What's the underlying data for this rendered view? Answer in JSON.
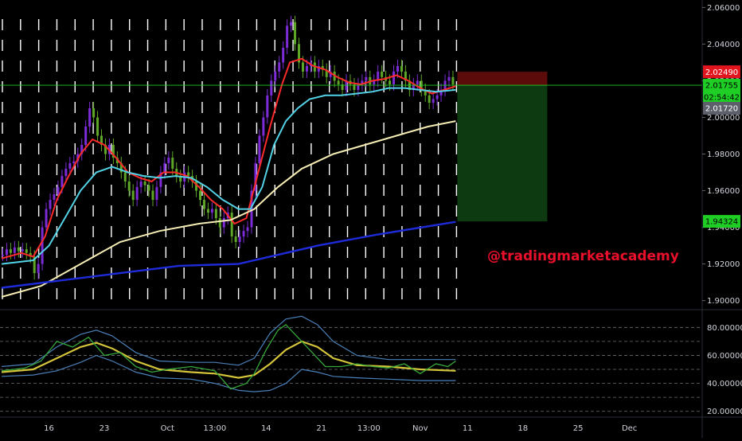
{
  "watermark": "@tradingmarketacademy",
  "colors": {
    "background": "#000000",
    "axis_text": "#d1d4dc",
    "candle_up": "#7b2cd6",
    "candle_down": "#5ea628",
    "ema_fast": "#ff2a2a",
    "ema_mid": "#53d2e6",
    "ema_slow": "#f6edb4",
    "ema_long": "#1e2bd8",
    "rsi_line": "#36a83a",
    "rsi_mean": "#d4c43a",
    "rsi_bands": "#4a80b8",
    "short_stop_zone": "#5c0b0b",
    "short_target_zone": "#0d3a10"
  },
  "price_axis": {
    "ticks": [
      "2.06000",
      "2.04000",
      "2.02000",
      "2.00000",
      "1.98000",
      "1.96000",
      "1.94000",
      "1.92000",
      "1.90000"
    ],
    "tick_values": [
      2.06,
      2.04,
      2.02,
      2.0,
      1.98,
      1.96,
      1.94,
      1.92,
      1.9
    ],
    "range": [
      1.8955,
      2.0632
    ]
  },
  "price_tags": [
    {
      "label": "2.02490",
      "value": 2.0249,
      "color": "#e0151e",
      "text_color": "#ffffff"
    },
    {
      "label": "2.01755",
      "value": 2.01755,
      "color": "#1fce24",
      "text_color": "#000000"
    },
    {
      "label": "02:54:42",
      "value": 2.0112,
      "color": "#1fce24",
      "text_color": "#000000"
    },
    {
      "label": "2.01720",
      "value": 2.005,
      "color": "#5d606b",
      "text_color": "#ffffff"
    },
    {
      "label": "1.94324",
      "value": 1.94324,
      "color": "#1fce24",
      "text_color": "#000000"
    }
  ],
  "indicator_axis": {
    "ticks": [
      "80.00000",
      "60.00000",
      "40.00000",
      "20.00000"
    ],
    "tick_values": [
      80,
      60,
      40,
      20
    ],
    "range": [
      17,
      91
    ]
  },
  "time_axis": {
    "labels": [
      "16",
      "23",
      "Oct",
      "13:00",
      "14",
      "21",
      "13:00",
      "Nov",
      "11",
      "18",
      "25",
      "Dec"
    ],
    "bar_index": [
      12,
      26,
      42,
      54,
      67,
      81,
      93,
      106,
      118,
      132,
      146,
      159
    ]
  },
  "chart_data": {
    "type": "candlestick",
    "title": "",
    "xlabel": "",
    "ylabel": "",
    "bar_count": 115,
    "last_price": 2.01755,
    "ylim": [
      1.8955,
      2.0632
    ],
    "ema_fast_period_note": "",
    "closes": [
      1.925,
      1.928,
      1.926,
      1.929,
      1.927,
      1.928,
      1.926,
      1.924,
      1.915,
      1.92,
      1.94,
      1.95,
      1.955,
      1.958,
      1.962,
      1.968,
      1.972,
      1.975,
      1.976,
      1.98,
      1.985,
      1.995,
      2.005,
      2.0,
      1.99,
      1.985,
      1.98,
      1.985,
      1.978,
      1.975,
      1.97,
      1.965,
      1.96,
      1.955,
      1.962,
      1.965,
      1.963,
      1.96,
      1.955,
      1.962,
      1.97,
      1.975,
      1.978,
      1.972,
      1.968,
      1.965,
      1.97,
      1.968,
      1.965,
      1.96,
      1.955,
      1.95,
      1.948,
      1.95,
      1.945,
      1.94,
      1.945,
      1.948,
      1.935,
      1.932,
      1.935,
      1.938,
      1.94,
      1.96,
      1.975,
      1.99,
      2.0,
      2.012,
      2.02,
      2.025,
      2.03,
      2.038,
      2.05,
      2.052,
      2.04,
      2.03,
      2.025,
      2.028,
      2.03,
      2.025,
      2.028,
      2.026,
      2.022,
      2.025,
      2.02,
      2.018,
      2.015,
      2.02,
      2.018,
      2.015,
      2.018,
      2.02,
      2.022,
      2.018,
      2.02,
      2.025,
      2.022,
      2.02,
      2.018,
      2.025,
      2.028,
      2.025,
      2.02,
      2.015,
      2.018,
      2.02,
      2.015,
      2.012,
      2.008,
      2.01,
      2.012,
      2.015,
      2.02,
      2.022,
      2.018
    ],
    "series": [
      {
        "name": "",
        "key": "ema_fast",
        "color": "#ff2a2a",
        "points": [
          [
            0,
            1.923
          ],
          [
            5,
            1.926
          ],
          [
            8,
            1.924
          ],
          [
            11,
            1.935
          ],
          [
            14,
            1.955
          ],
          [
            17,
            1.968
          ],
          [
            20,
            1.98
          ],
          [
            23,
            1.988
          ],
          [
            26,
            1.985
          ],
          [
            29,
            1.978
          ],
          [
            32,
            1.97
          ],
          [
            35,
            1.967
          ],
          [
            38,
            1.965
          ],
          [
            41,
            1.97
          ],
          [
            44,
            1.97
          ],
          [
            47,
            1.968
          ],
          [
            50,
            1.962
          ],
          [
            53,
            1.955
          ],
          [
            56,
            1.95
          ],
          [
            59,
            1.942
          ],
          [
            62,
            1.945
          ],
          [
            65,
            1.97
          ],
          [
            68,
            1.995
          ],
          [
            71,
            2.018
          ],
          [
            73,
            2.03
          ],
          [
            76,
            2.032
          ],
          [
            79,
            2.028
          ],
          [
            82,
            2.026
          ],
          [
            85,
            2.022
          ],
          [
            88,
            2.019
          ],
          [
            91,
            2.018
          ],
          [
            94,
            2.02
          ],
          [
            97,
            2.021
          ],
          [
            100,
            2.023
          ],
          [
            103,
            2.02
          ],
          [
            106,
            2.016
          ],
          [
            109,
            2.013
          ],
          [
            112,
            2.015
          ],
          [
            115,
            2.017
          ]
        ]
      },
      {
        "name": "",
        "key": "ema_mid",
        "color": "#53d2e6",
        "points": [
          [
            0,
            1.92
          ],
          [
            8,
            1.922
          ],
          [
            12,
            1.93
          ],
          [
            16,
            1.945
          ],
          [
            20,
            1.96
          ],
          [
            24,
            1.97
          ],
          [
            28,
            1.973
          ],
          [
            32,
            1.97
          ],
          [
            36,
            1.968
          ],
          [
            40,
            1.967
          ],
          [
            44,
            1.968
          ],
          [
            48,
            1.967
          ],
          [
            52,
            1.962
          ],
          [
            56,
            1.955
          ],
          [
            60,
            1.95
          ],
          [
            63,
            1.95
          ],
          [
            66,
            1.962
          ],
          [
            69,
            1.985
          ],
          [
            72,
            1.998
          ],
          [
            75,
            2.005
          ],
          [
            78,
            2.01
          ],
          [
            82,
            2.012
          ],
          [
            86,
            2.012
          ],
          [
            90,
            2.013
          ],
          [
            94,
            2.014
          ],
          [
            98,
            2.016
          ],
          [
            102,
            2.016
          ],
          [
            106,
            2.015
          ],
          [
            110,
            2.014
          ],
          [
            115,
            2.015
          ]
        ]
      },
      {
        "name": "",
        "key": "ema_slow",
        "color": "#f6edb4",
        "points": [
          [
            0,
            1.902
          ],
          [
            10,
            1.908
          ],
          [
            20,
            1.92
          ],
          [
            30,
            1.932
          ],
          [
            40,
            1.938
          ],
          [
            50,
            1.942
          ],
          [
            58,
            1.944
          ],
          [
            64,
            1.95
          ],
          [
            70,
            1.962
          ],
          [
            76,
            1.972
          ],
          [
            84,
            1.98
          ],
          [
            92,
            1.985
          ],
          [
            100,
            1.99
          ],
          [
            108,
            1.995
          ],
          [
            115,
            1.998
          ]
        ]
      },
      {
        "name": "",
        "key": "ema_long",
        "color": "#1e2bd8",
        "points": [
          [
            0,
            1.907
          ],
          [
            15,
            1.911
          ],
          [
            30,
            1.915
          ],
          [
            45,
            1.919
          ],
          [
            60,
            1.92
          ],
          [
            70,
            1.925
          ],
          [
            80,
            1.93
          ],
          [
            95,
            1.936
          ],
          [
            115,
            1.943
          ]
        ]
      }
    ],
    "position_tool": {
      "type": "short",
      "entry": 2.01755,
      "stop": 2.0249,
      "target": 1.94324
    },
    "indicator": {
      "name": "",
      "ylim": [
        17,
        91
      ],
      "levels": [
        80,
        70,
        60,
        50,
        40,
        30,
        20
      ],
      "rsi": [
        [
          0,
          49
        ],
        [
          6,
          51
        ],
        [
          10,
          56
        ],
        [
          14,
          70
        ],
        [
          18,
          66
        ],
        [
          22,
          73
        ],
        [
          26,
          60
        ],
        [
          30,
          62
        ],
        [
          34,
          52
        ],
        [
          38,
          48
        ],
        [
          42,
          50
        ],
        [
          48,
          52
        ],
        [
          54,
          49
        ],
        [
          58,
          36
        ],
        [
          62,
          40
        ],
        [
          64,
          47
        ],
        [
          67,
          64
        ],
        [
          70,
          78
        ],
        [
          72,
          82
        ],
        [
          74,
          76
        ],
        [
          76,
          70
        ],
        [
          78,
          64
        ],
        [
          82,
          52
        ],
        [
          86,
          52
        ],
        [
          90,
          54
        ],
        [
          94,
          52
        ],
        [
          98,
          51
        ],
        [
          102,
          54
        ],
        [
          106,
          47
        ],
        [
          110,
          54
        ],
        [
          113,
          52
        ],
        [
          115,
          56
        ]
      ],
      "mean": [
        [
          0,
          48
        ],
        [
          8,
          50
        ],
        [
          14,
          58
        ],
        [
          20,
          66
        ],
        [
          24,
          69
        ],
        [
          28,
          65
        ],
        [
          34,
          56
        ],
        [
          40,
          50
        ],
        [
          48,
          48
        ],
        [
          54,
          47
        ],
        [
          60,
          44
        ],
        [
          64,
          46
        ],
        [
          68,
          54
        ],
        [
          72,
          64
        ],
        [
          76,
          70
        ],
        [
          80,
          66
        ],
        [
          84,
          58
        ],
        [
          90,
          53
        ],
        [
          98,
          52
        ],
        [
          106,
          50
        ],
        [
          115,
          49
        ]
      ],
      "upper": [
        [
          0,
          52
        ],
        [
          8,
          54
        ],
        [
          14,
          66
        ],
        [
          20,
          75
        ],
        [
          24,
          78
        ],
        [
          28,
          74
        ],
        [
          34,
          62
        ],
        [
          40,
          56
        ],
        [
          48,
          55
        ],
        [
          54,
          55
        ],
        [
          60,
          53
        ],
        [
          64,
          58
        ],
        [
          68,
          76
        ],
        [
          72,
          86
        ],
        [
          76,
          88
        ],
        [
          80,
          82
        ],
        [
          84,
          70
        ],
        [
          90,
          60
        ],
        [
          98,
          57
        ],
        [
          106,
          57
        ],
        [
          115,
          57
        ]
      ],
      "lower": [
        [
          0,
          45
        ],
        [
          8,
          46
        ],
        [
          14,
          49
        ],
        [
          20,
          55
        ],
        [
          24,
          60
        ],
        [
          28,
          56
        ],
        [
          34,
          48
        ],
        [
          40,
          44
        ],
        [
          48,
          43
        ],
        [
          54,
          40
        ],
        [
          60,
          35
        ],
        [
          64,
          34
        ],
        [
          68,
          35
        ],
        [
          72,
          40
        ],
        [
          76,
          50
        ],
        [
          80,
          48
        ],
        [
          84,
          45
        ],
        [
          90,
          44
        ],
        [
          98,
          43
        ],
        [
          106,
          42
        ],
        [
          115,
          42
        ]
      ]
    }
  }
}
